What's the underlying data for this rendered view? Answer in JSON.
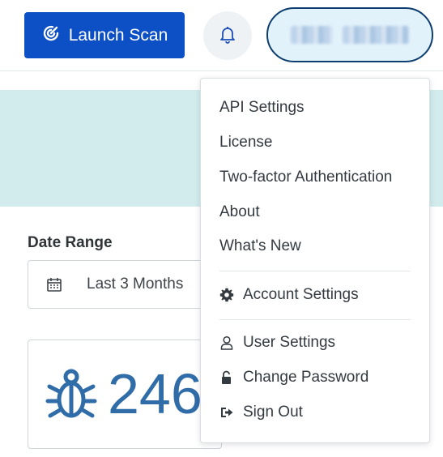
{
  "header": {
    "launch_label": "Launch Scan",
    "accent": "#0d4fc4"
  },
  "filters": {
    "date_range_label": "Date Range",
    "date_range_value": "Last 3 Months"
  },
  "stats": {
    "bug_count": "246"
  },
  "menu": {
    "items_top": [
      {
        "label": "API Settings"
      },
      {
        "label": "License"
      },
      {
        "label": "Two-factor Authentication"
      },
      {
        "label": "About"
      },
      {
        "label": "What's New"
      }
    ],
    "account_settings": {
      "label": "Account Settings",
      "icon": "gear-icon"
    },
    "items_bottom": [
      {
        "label": "User Settings",
        "icon": "user-icon"
      },
      {
        "label": "Change Password",
        "icon": "unlock-icon"
      },
      {
        "label": "Sign Out",
        "icon": "sign-out-icon"
      }
    ]
  }
}
